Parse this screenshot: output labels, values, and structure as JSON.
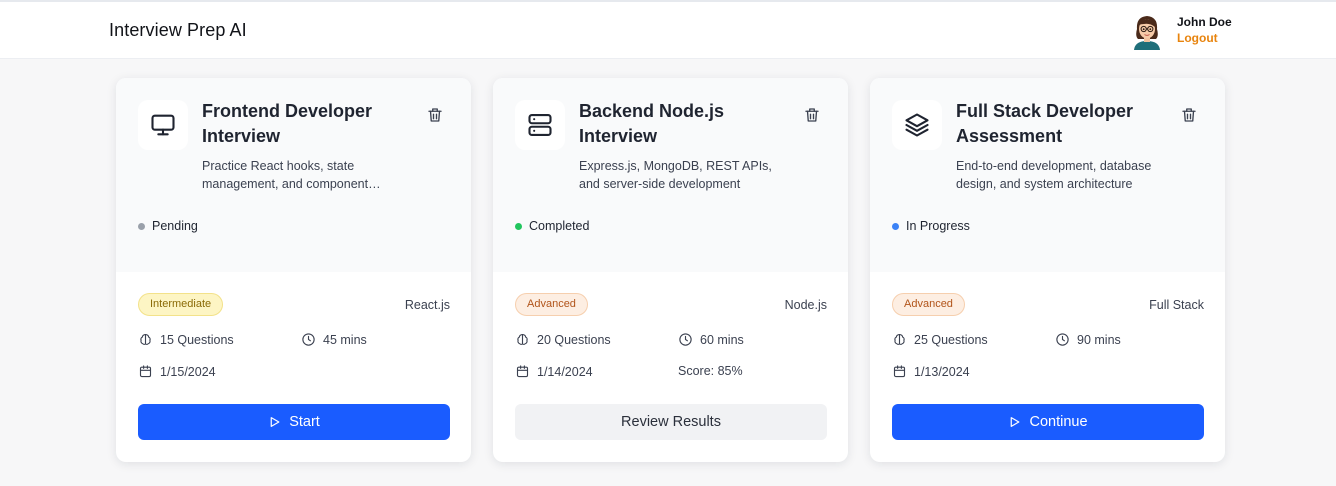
{
  "app": {
    "title": "Interview Prep AI"
  },
  "user": {
    "name": "John Doe",
    "logout_label": "Logout"
  },
  "colors": {
    "primary": "#1a5cff",
    "accent": "#e8840e",
    "pending": "#9aa0aa",
    "completed": "#22c55e",
    "in_progress": "#3b82f6"
  },
  "cards": [
    {
      "icon": "monitor-icon",
      "title": "Frontend Developer Interview",
      "description": "Practice React hooks, state management, and component…",
      "status": "Pending",
      "level": "Intermediate",
      "tech": "React.js",
      "questions": "15 Questions",
      "duration": "45 mins",
      "date": "1/15/2024",
      "score": "",
      "action": "Start"
    },
    {
      "icon": "server-icon",
      "title": "Backend Node.js Interview",
      "description": "Express.js, MongoDB, REST APIs, and server-side development",
      "status": "Completed",
      "level": "Advanced",
      "tech": "Node.js",
      "questions": "20 Questions",
      "duration": "60 mins",
      "date": "1/14/2024",
      "score": "Score: 85%",
      "action": "Review Results"
    },
    {
      "icon": "layers-icon",
      "title": "Full Stack Developer Assessment",
      "description": "End-to-end development, database design, and system architecture",
      "status": "In Progress",
      "level": "Advanced",
      "tech": "Full Stack",
      "questions": "25 Questions",
      "duration": "90 mins",
      "date": "1/13/2024",
      "score": "",
      "action": "Continue"
    }
  ]
}
